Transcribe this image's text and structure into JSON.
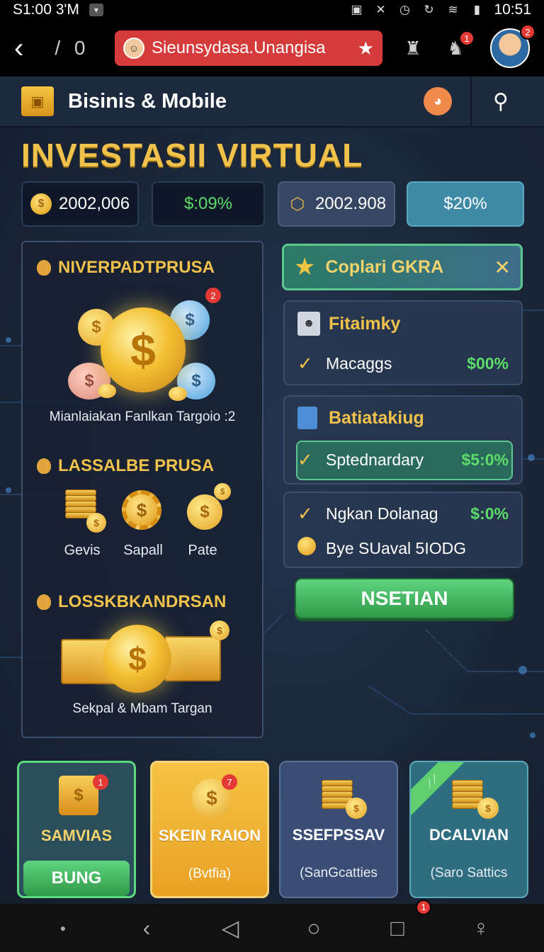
{
  "status": {
    "time_left": "S1:00 3'M",
    "time_right": "10:51"
  },
  "appbar": {
    "page_counter": "/ 0",
    "url_text": "Sieunsydasa.Unangisa",
    "notif_badge": "1",
    "profile_badge": "2"
  },
  "header": {
    "title": "Bisinis & Mobile"
  },
  "page_title": "INVESTASII VIRTUAL",
  "stats": [
    {
      "value": "2002,006",
      "icon": "coin-icon"
    },
    {
      "value": "$:09%",
      "color": "#5ddc6a"
    },
    {
      "value": "2002.908",
      "icon": "cube-icon"
    },
    {
      "value": "$20%"
    }
  ],
  "left_panel": {
    "section1": {
      "heading": "NIVERPADTPRUSA",
      "badge": "2",
      "caption": "Mianlaiakan Fanlkan Targoio :2"
    },
    "section2": {
      "heading": "LASSALBE PRUSA",
      "items": [
        "Gevis",
        "Sapall",
        "Pate"
      ]
    },
    "section3": {
      "heading": "LOSSKBKANDRSAN",
      "caption": "Sekpal & Mbam Targan"
    }
  },
  "right_panel": {
    "banner": {
      "title": "Coplari GKRA"
    },
    "card1": {
      "header": "Fitaimky",
      "row_label": "Macaggs",
      "row_value": "$00%"
    },
    "card2": {
      "header": "Batiatakiug",
      "row_label": "Sptednardary",
      "row_value": "$5:0%"
    },
    "card3": {
      "row1_label": "Ngkan Dolanag",
      "row1_value": "$:0%",
      "row2_label": "Bye SUaval 5IODG"
    },
    "cta_label": "NSETIAN"
  },
  "cards": [
    {
      "title": "SAMVIAS",
      "button": "BUNG",
      "badge": "1"
    },
    {
      "title": "SKEIN RAION",
      "subtitle": "(Bvtfia)",
      "badge": "7"
    },
    {
      "title": "SSEFPSSAV",
      "subtitle": "(SanGcatties"
    },
    {
      "title": "DCALVIAN",
      "subtitle": "(Saro Sattics"
    }
  ],
  "navbar": {
    "badge": "1"
  },
  "colors": {
    "accent_gold": "#f0c24b",
    "accent_green": "#5ddc6a",
    "url_red": "#d63b3b",
    "background": "#1a2638"
  }
}
